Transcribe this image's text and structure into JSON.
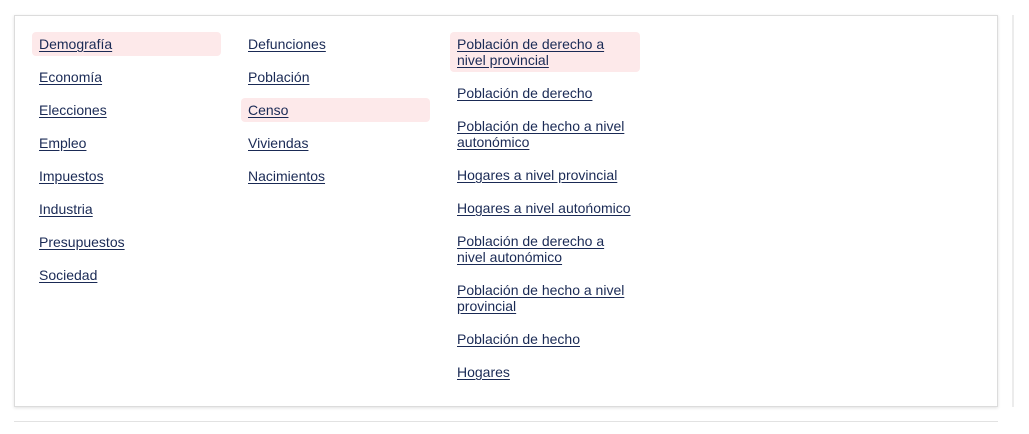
{
  "menu": {
    "categories": [
      {
        "label": "Demografía",
        "active": true
      },
      {
        "label": "Economía",
        "active": false
      },
      {
        "label": "Elecciones",
        "active": false
      },
      {
        "label": "Empleo",
        "active": false
      },
      {
        "label": "Impuestos",
        "active": false
      },
      {
        "label": "Industria",
        "active": false
      },
      {
        "label": "Presupuestos",
        "active": false
      },
      {
        "label": "Sociedad",
        "active": false
      }
    ],
    "subcategories": [
      {
        "label": "Defunciones",
        "active": false
      },
      {
        "label": "Población",
        "active": false
      },
      {
        "label": "Censo",
        "active": true
      },
      {
        "label": "Viviendas",
        "active": false
      },
      {
        "label": "Nacimientos",
        "active": false
      }
    ],
    "datasets": [
      {
        "label": "Población de derecho a nivel provincial",
        "active": true
      },
      {
        "label": "Población de derecho",
        "active": false
      },
      {
        "label": "Población de hecho a nivel autonómico",
        "active": false
      },
      {
        "label": "Hogares a nivel provincial",
        "active": false
      },
      {
        "label": "Hogares a nivel autońomico",
        "active": false
      },
      {
        "label": "Población de derecho a nivel autonómico",
        "active": false
      },
      {
        "label": "Población de hecho a nivel provincial",
        "active": false
      },
      {
        "label": "Población de hecho",
        "active": false
      },
      {
        "label": "Hogares",
        "active": false
      }
    ]
  },
  "colors": {
    "link": "#1a2a55",
    "active_background": "#fde9ea",
    "panel_border": "#dcdcdc"
  }
}
